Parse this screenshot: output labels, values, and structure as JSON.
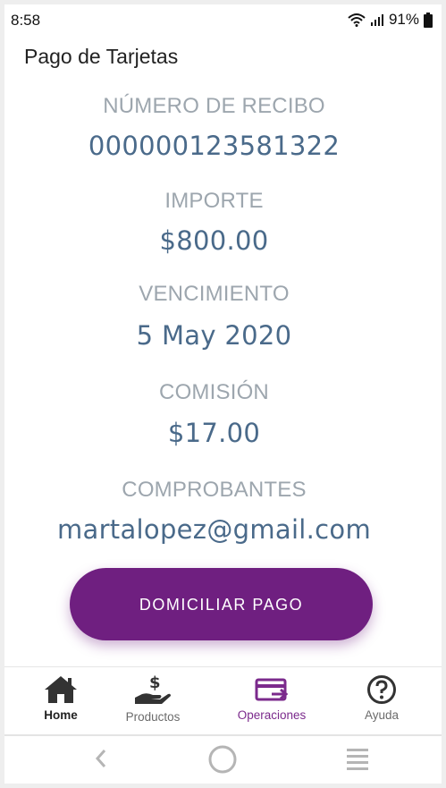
{
  "status_bar": {
    "time": "8:58",
    "battery": "91%"
  },
  "header": {
    "title": "Pago de Tarjetas"
  },
  "details": {
    "receipt_label": "NÚMERO DE RECIBO",
    "receipt_value": "000000123581322",
    "amount_label": "IMPORTE",
    "amount_value": "$800.00",
    "due_label": "VENCIMIENTO",
    "due_value": "5 May 2020",
    "fee_label": "COMISIÓN",
    "fee_value": "$17.00",
    "vouchers_label": "COMPROBANTES",
    "vouchers_value": "martalopez@gmail.com"
  },
  "action": {
    "button_label": "DOMICILIAR PAGO"
  },
  "bottom_nav": {
    "items": [
      {
        "label": "Home",
        "icon": "home-icon",
        "color": "#222222"
      },
      {
        "label": "Productos",
        "icon": "hand-money-icon",
        "color": "#6b6b6b"
      },
      {
        "label": "Operaciones",
        "icon": "card-transfer-icon",
        "color": "#7b2a8c"
      },
      {
        "label": "Ayuda",
        "icon": "help-icon",
        "color": "#6b6b6b"
      }
    ]
  },
  "colors": {
    "accent": "#6f1f80",
    "value_text": "#4a6a8a",
    "label_text": "#9da6ae"
  }
}
